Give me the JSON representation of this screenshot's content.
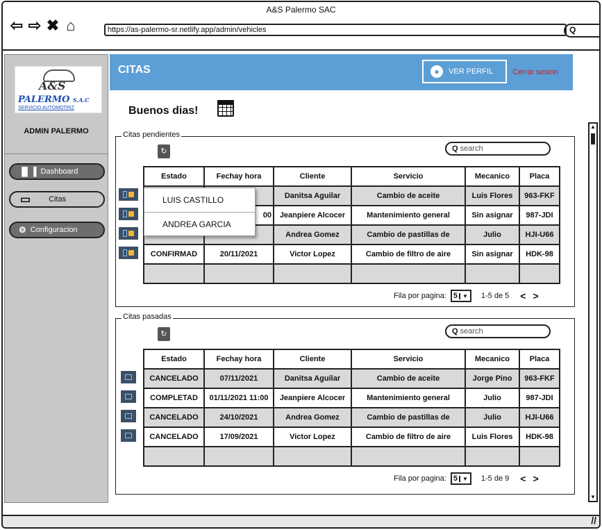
{
  "browser": {
    "title": "A&S Palermo SAC",
    "url": "https://as-palermo-sr.netlify.app/admin/vehicles",
    "nav_icons": [
      "back-icon",
      "forward-icon",
      "close-icon",
      "home-icon"
    ],
    "search_glyph": "Q"
  },
  "sidebar": {
    "logo": {
      "line1": "A&S",
      "line2": "PALERMO",
      "line2_suffix": "S.A.C",
      "line3": "SERVICIO AUTOMOTRIZ"
    },
    "admin_label": "ADMIN PALERMO",
    "items": [
      {
        "label": "Dashboard",
        "icon": "bar-chart-icon",
        "active": false
      },
      {
        "label": "Citas",
        "icon": "calendar-icon",
        "active": true
      },
      {
        "label": "Configuracion",
        "icon": "gear-icon",
        "active": false
      }
    ]
  },
  "header": {
    "title": "CITAS",
    "profile_label": "VER PERFIL",
    "logout_label": "Cerrar sesion",
    "accent_color": "#5c9fd6",
    "logout_color": "#c82020"
  },
  "greeting": "Buenos dias!",
  "pending": {
    "legend": "Citas pendientes",
    "search_placeholder": "search",
    "columns": [
      "Estado",
      "Fechay hora",
      "Cliente",
      "Servicio",
      "Mecanico",
      "Placa"
    ],
    "rows": [
      [
        "",
        "",
        "Danitsa Aguilar",
        "Cambio de aceite",
        "Luis Flores",
        "963-FKF"
      ],
      [
        "",
        "00",
        "Jeanpiere Alcocer",
        "Mantenimiento general",
        "Sin asignar",
        "987-JDI"
      ],
      [
        "",
        "",
        "Andrea Gomez",
        "Cambio de pastillas de",
        "Julio",
        "HJI-U66"
      ],
      [
        "CONFIRMAD",
        "20/11/2021",
        "Victor Lopez",
        "Cambio de filtro de aire",
        "Sin asignar",
        "HDK-98"
      ]
    ],
    "pager": {
      "label": "Fila por pagina:",
      "per_page": "5",
      "range": "1-5 de 5",
      "prev": "<",
      "next": ">"
    }
  },
  "dropdown": {
    "options": [
      "LUIS CASTILLO",
      "ANDREA GARCIA"
    ]
  },
  "past": {
    "legend": "Citas pasadas",
    "search_placeholder": "search",
    "columns": [
      "Estado",
      "Fechay hora",
      "Cliente",
      "Servicio",
      "Mecanico",
      "Placa"
    ],
    "rows": [
      [
        "CANCELADO",
        "07/11/2021",
        "Danitsa Aguilar",
        "Cambio de aceite",
        "Jorge Pino",
        "963-FKF"
      ],
      [
        "COMPLETAD",
        "01/11/2021 11:00",
        "Jeanpiere Alcocer",
        "Mantenimiento general",
        "Julio",
        "987-JDI"
      ],
      [
        "CANCELADO",
        "24/10/2021",
        "Andrea Gomez",
        "Cambio de pastillas de",
        "Julio",
        "HJI-U66"
      ],
      [
        "CANCELADO",
        "17/09/2021",
        "Victor Lopez",
        "Cambio de filtro de aire",
        "Luis Flores",
        "HDK-98"
      ]
    ],
    "pager": {
      "label": "Fila por pagina:",
      "per_page": "5",
      "range": "1-5 de 9",
      "prev": "<",
      "next": ">"
    }
  }
}
